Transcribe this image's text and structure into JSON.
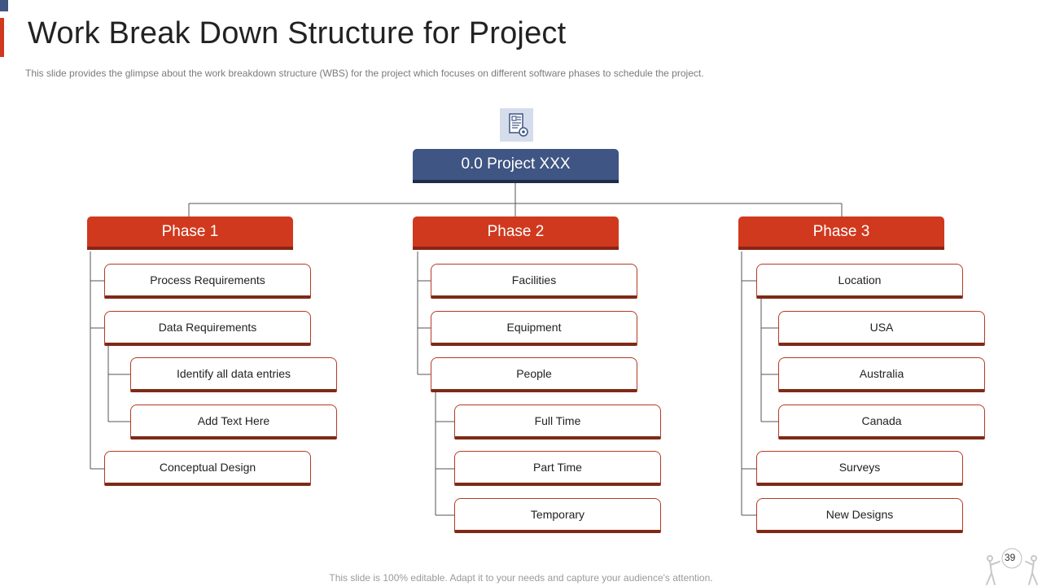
{
  "title": "Work Break Down Structure for Project",
  "subtitle": "This slide provides  the glimpse about the work breakdown  structure (WBS) for the project which focuses on different  software  phases to schedule the project.",
  "root": {
    "label": "0.0 Project XXX",
    "icon": "document-gear-icon"
  },
  "phases": [
    {
      "label": "Phase 1",
      "items": [
        "Process Requirements",
        "Data Requirements",
        "Identify all data entries",
        "Add Text Here",
        "Conceptual Design"
      ]
    },
    {
      "label": "Phase 2",
      "items": [
        "Facilities",
        "Equipment",
        "People",
        "Full Time",
        "Part Time",
        "Temporary"
      ]
    },
    {
      "label": "Phase 3",
      "items": [
        "Location",
        "USA",
        "Australia",
        "Canada",
        "Surveys",
        "New Designs"
      ]
    }
  ],
  "page_number": "39",
  "footer": "This slide is 100% editable. Adapt it to your needs and capture your audience's attention.",
  "colors": {
    "accent": "#d0391e",
    "navy": "#3f5583",
    "connector": "#555555"
  }
}
